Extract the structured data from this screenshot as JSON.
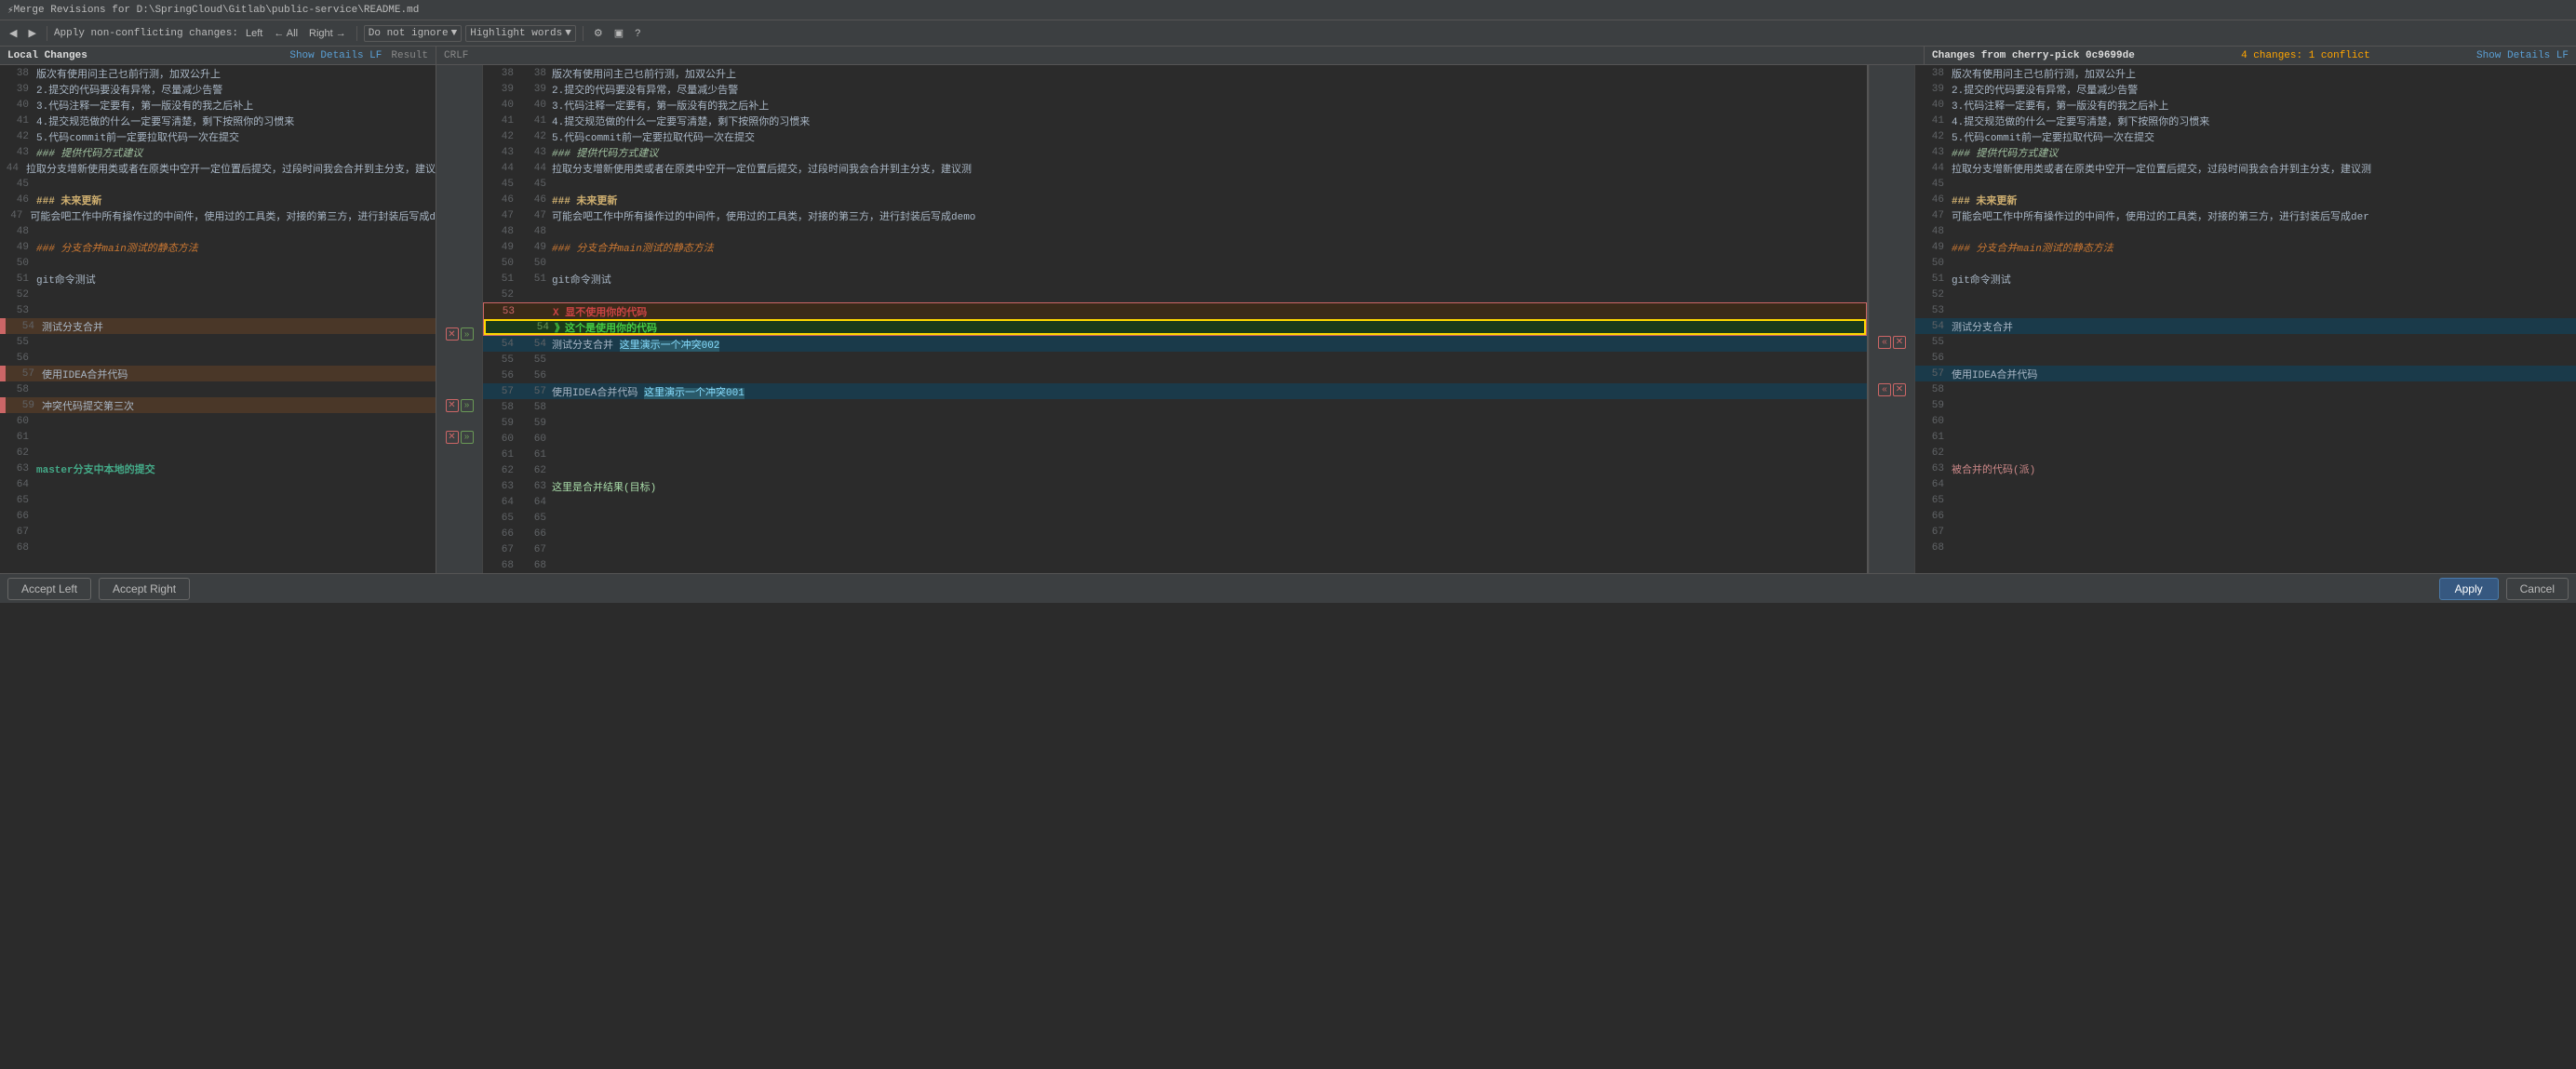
{
  "titlebar": {
    "icon": "⚡",
    "title": "Merge Revisions for D:\\SpringCloud\\Gitlab\\public-service\\README.md"
  },
  "toolbar": {
    "apply_non_conflicting": "Apply non-conflicting changes:",
    "left_label": "Left",
    "all_label": "← All",
    "right_label": "Right →",
    "do_not_ignore_label": "Do not ignore",
    "highlight_words_label": "Highlight words",
    "help_icon": "?"
  },
  "panels": {
    "left_header": "Local Changes",
    "left_show_details": "Show Details LF",
    "center_result_label": "Result",
    "center_crlf": "CRLF",
    "right_header": "Changes from cherry-pick 0c9699de",
    "right_show_details": "Show Details LF",
    "right_changes": "4 changes: 1 conflict"
  },
  "left_lines": [
    {
      "ln": "38",
      "content": "版次有使用问主己乜前行测，加双公升上",
      "class": ""
    },
    {
      "ln": "39",
      "content": "2.提交的代码要没有异常，尽量减少告警",
      "class": ""
    },
    {
      "ln": "40",
      "content": "3.代码注释一定要有，第一版没有的我之后补上",
      "class": ""
    },
    {
      "ln": "41",
      "content": "4.提交规范做的什么一定要写清楚，剩下按照你的习惯来",
      "class": ""
    },
    {
      "ln": "42",
      "content": "5.代码commit前一定要拉取代码一次在提交",
      "class": ""
    },
    {
      "ln": "43",
      "content": "### 提供代码方式建议",
      "class": "text-italic"
    },
    {
      "ln": "44",
      "content": "拉取分支增新使用类或者在原类中空开一定位置后提交，过段时间我会合并到主分支，建议...",
      "class": ""
    },
    {
      "ln": "45",
      "content": "",
      "class": ""
    },
    {
      "ln": "46",
      "content": "### 未来更新",
      "class": "text-heading"
    },
    {
      "ln": "47",
      "content": "可能会吧工作中所有操作过的中间件，使用过的工具类，对接的第三方，进行封装后写成d",
      "class": ""
    },
    {
      "ln": "48",
      "content": "",
      "class": ""
    },
    {
      "ln": "49",
      "content": "### 分支合并main测试的静态方法",
      "class": "text-italic-orange"
    },
    {
      "ln": "50",
      "content": "",
      "class": ""
    },
    {
      "ln": "51",
      "content": "git命令测试",
      "class": ""
    },
    {
      "ln": "52",
      "content": "",
      "class": ""
    },
    {
      "ln": "53",
      "content": "",
      "class": ""
    },
    {
      "ln": "54",
      "content": "测试分支合并",
      "class": "conflict-left"
    },
    {
      "ln": "55",
      "content": "",
      "class": ""
    },
    {
      "ln": "56",
      "content": "",
      "class": ""
    },
    {
      "ln": "57",
      "content": "使用IDEA合并代码",
      "class": "conflict-left"
    },
    {
      "ln": "58",
      "content": "",
      "class": ""
    },
    {
      "ln": "59",
      "content": "冲突代码提交第三次",
      "class": "conflict-left"
    },
    {
      "ln": "60",
      "content": "",
      "class": ""
    },
    {
      "ln": "61",
      "content": "",
      "class": ""
    },
    {
      "ln": "62",
      "content": "",
      "class": ""
    },
    {
      "ln": "63",
      "content": "",
      "class": ""
    },
    {
      "ln": "64",
      "content": "",
      "class": ""
    },
    {
      "ln": "65",
      "content": "",
      "class": ""
    },
    {
      "ln": "66",
      "content": "",
      "class": ""
    },
    {
      "ln": "67",
      "content": "",
      "class": ""
    },
    {
      "ln": "68",
      "content": "",
      "class": ""
    }
  ],
  "center_lines": [
    {
      "ln1": "38",
      "ln2": "38",
      "content": "版次有使用问主己乜前行测，加双公升上",
      "class": ""
    },
    {
      "ln1": "39",
      "ln2": "39",
      "content": "2.提交的代码要没有异常，尽量减少告警",
      "class": ""
    },
    {
      "ln1": "40",
      "ln2": "40",
      "content": "3.代码注释一定要有，第一版没有的我之后补上",
      "class": ""
    },
    {
      "ln1": "41",
      "ln2": "41",
      "content": "4.提交规范做的什么一定要写清楚，剩下按照你的习惯来",
      "class": ""
    },
    {
      "ln1": "42",
      "ln2": "42",
      "content": "5.代码commit前一定要拉取代码一次在提交",
      "class": ""
    },
    {
      "ln1": "43",
      "ln2": "43",
      "content": "### 提供代码方式建议",
      "class": "text-italic"
    },
    {
      "ln1": "44",
      "ln2": "44",
      "content": "拉取分支增新使用类或者在原类中空开一定位置后提交，过段时间我会合并到主分支，建议测...",
      "class": ""
    },
    {
      "ln1": "45",
      "ln2": "45",
      "content": "",
      "class": ""
    },
    {
      "ln1": "46",
      "ln2": "46",
      "content": "### 未来更新",
      "class": "text-heading"
    },
    {
      "ln1": "47",
      "ln2": "47",
      "content": "可能会吧工作中所有操作过的中间件，使用过的工具类，对接的第三方，进行封装后写成demo",
      "class": ""
    },
    {
      "ln1": "48",
      "ln2": "48",
      "content": "",
      "class": ""
    },
    {
      "ln1": "49",
      "ln2": "49",
      "content": "### 分支合并main测试的静态方法",
      "class": "text-italic-orange"
    },
    {
      "ln1": "50",
      "ln2": "50",
      "content": "",
      "class": ""
    },
    {
      "ln1": "51",
      "ln2": "51",
      "content": "git命令测试",
      "class": ""
    },
    {
      "ln1": "52",
      "ln2": "",
      "content": "",
      "class": ""
    },
    {
      "ln1": "53",
      "ln2": "",
      "content": "X 显不使用你的代码 (annotation)",
      "class": "annotation"
    },
    {
      "ln1": "54",
      "ln2": "54",
      "content": "测试分支合并 这里演示一个冲突002",
      "class": "conflict-right"
    },
    {
      "ln1": "55",
      "ln2": "55",
      "content": "",
      "class": ""
    },
    {
      "ln1": "56",
      "ln2": "56",
      "content": "",
      "class": ""
    },
    {
      "ln1": "57",
      "ln2": "57",
      "content": "使用IDEA合并代码 这里演示一个冲突001",
      "class": "conflict-right"
    },
    {
      "ln1": "58",
      "ln2": "58",
      "content": "",
      "class": ""
    },
    {
      "ln1": "59",
      "ln2": "59",
      "content": "",
      "class": ""
    },
    {
      "ln1": "60",
      "ln2": "60",
      "content": "",
      "class": ""
    },
    {
      "ln1": "61",
      "ln2": "61",
      "content": "",
      "class": ""
    },
    {
      "ln1": "62",
      "ln2": "62",
      "content": "",
      "class": ""
    },
    {
      "ln1": "63",
      "ln2": "63",
      "content": "这里是合并结果(目标)",
      "class": ""
    },
    {
      "ln1": "64",
      "ln2": "64",
      "content": "",
      "class": ""
    },
    {
      "ln1": "65",
      "ln2": "65",
      "content": "",
      "class": ""
    },
    {
      "ln1": "66",
      "ln2": "66",
      "content": "",
      "class": ""
    },
    {
      "ln1": "67",
      "ln2": "67",
      "content": "",
      "class": ""
    },
    {
      "ln1": "68",
      "ln2": "68",
      "content": "",
      "class": ""
    }
  ],
  "right_lines": [
    {
      "ln": "38",
      "content": "版次有使用问主己乜前行测，加双公升上",
      "class": ""
    },
    {
      "ln": "39",
      "content": "2.提交的代码要没有异常，尽量减少告警",
      "class": ""
    },
    {
      "ln": "40",
      "content": "3.代码注释一定要有，第一版没有的我之后补上",
      "class": ""
    },
    {
      "ln": "41",
      "content": "4.提交规范做的什么一定要写清楚，剩下按照你的习惯来",
      "class": ""
    },
    {
      "ln": "42",
      "content": "5.代码commit前一定要拉取代码一次在提交",
      "class": ""
    },
    {
      "ln": "43",
      "content": "### 提供代码方式建议",
      "class": "text-italic"
    },
    {
      "ln": "44",
      "content": "拉取分支增新使用类或者在原类中空开一定位置后提交，过段时间我会合并到主分支，建议测...",
      "class": ""
    },
    {
      "ln": "45",
      "content": "",
      "class": ""
    },
    {
      "ln": "46",
      "content": "### 未来更新",
      "class": "text-heading"
    },
    {
      "ln": "47",
      "content": "可能会吧工作中所有操作过的中间件，使用过的工具类，对接的第三方，进行封装后写成der",
      "class": ""
    },
    {
      "ln": "48",
      "content": "",
      "class": ""
    },
    {
      "ln": "49",
      "content": "### 分支合并main测试的静态方法",
      "class": "text-italic-orange"
    },
    {
      "ln": "50",
      "content": "",
      "class": ""
    },
    {
      "ln": "51",
      "content": "git命令测试",
      "class": ""
    },
    {
      "ln": "52",
      "content": "",
      "class": ""
    },
    {
      "ln": "53",
      "content": "",
      "class": ""
    },
    {
      "ln": "54",
      "content": "测试分支合并",
      "class": "conflict-right"
    },
    {
      "ln": "55",
      "content": "",
      "class": ""
    },
    {
      "ln": "56",
      "content": "",
      "class": ""
    },
    {
      "ln": "57",
      "content": "使用IDEA合并代码",
      "class": "conflict-right"
    },
    {
      "ln": "58",
      "content": "",
      "class": ""
    },
    {
      "ln": "59",
      "content": "",
      "class": ""
    },
    {
      "ln": "60",
      "content": "",
      "class": ""
    },
    {
      "ln": "61",
      "content": "",
      "class": ""
    },
    {
      "ln": "62",
      "content": "",
      "class": ""
    },
    {
      "ln": "63",
      "content": "",
      "class": ""
    },
    {
      "ln": "64",
      "content": "",
      "class": ""
    },
    {
      "ln": "65",
      "content": "",
      "class": ""
    },
    {
      "ln": "66",
      "content": "",
      "class": ""
    },
    {
      "ln": "67",
      "content": "",
      "class": ""
    },
    {
      "ln": "68",
      "content": "",
      "class": ""
    }
  ],
  "annotations": {
    "x_label": "X 显不使用你的代码",
    "check_label": "》这个是使用你的代码",
    "merged_label": "被合并的代码(派)",
    "master_label": "master分支中本地的提交",
    "result_label": "这里是合并结果(目标)"
  },
  "bottom": {
    "accept_left": "Accept Left",
    "accept_right": "Accept Right",
    "apply": "Apply",
    "cancel": "Cancel"
  }
}
